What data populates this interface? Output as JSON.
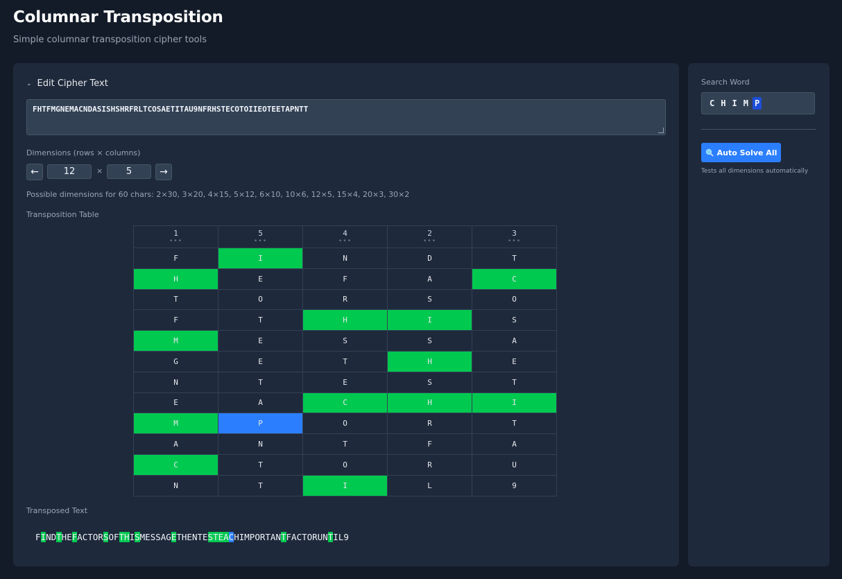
{
  "header": {
    "title": "Columnar Transposition",
    "subtitle": "Simple columnar transposition cipher tools"
  },
  "editor": {
    "toggle_label": "Edit Cipher Text",
    "cipher_text": "FHTFMGNEMACNDASISHSHRFRLTCOSAETITAU9NFRHSTECOTOIIEOTEETAPNTT"
  },
  "dimensions": {
    "label": "Dimensions (rows × columns)",
    "prev_label": "←",
    "next_label": "→",
    "rows": "12",
    "times": "×",
    "cols": "5",
    "possible_text": "Possible dimensions for 60 chars: 2×30, 3×20, 4×15, 5×12, 6×10, 10×6, 12×5, 15×4, 20×3, 30×2"
  },
  "table": {
    "label": "Transposition Table",
    "headers": [
      "1",
      "5",
      "4",
      "2",
      "3"
    ],
    "rows": [
      [
        "F",
        "I",
        "N",
        "D",
        "T"
      ],
      [
        "H",
        "E",
        "F",
        "A",
        "C"
      ],
      [
        "T",
        "O",
        "R",
        "S",
        "O"
      ],
      [
        "F",
        "T",
        "H",
        "I",
        "S"
      ],
      [
        "M",
        "E",
        "S",
        "S",
        "A"
      ],
      [
        "G",
        "E",
        "T",
        "H",
        "E"
      ],
      [
        "N",
        "T",
        "E",
        "S",
        "T"
      ],
      [
        "E",
        "A",
        "C",
        "H",
        "I"
      ],
      [
        "M",
        "P",
        "O",
        "R",
        "T"
      ],
      [
        "A",
        "N",
        "T",
        "F",
        "A"
      ],
      [
        "C",
        "T",
        "O",
        "R",
        "U"
      ],
      [
        "N",
        "T",
        "I",
        "L",
        "9"
      ]
    ],
    "highlights": [
      [
        "",
        "g",
        "",
        "",
        ""
      ],
      [
        "g",
        "",
        "",
        "",
        "g"
      ],
      [
        "",
        "",
        "",
        "",
        ""
      ],
      [
        "",
        "",
        "g",
        "g",
        ""
      ],
      [
        "g",
        "",
        "",
        "",
        ""
      ],
      [
        "",
        "",
        "",
        "g",
        ""
      ],
      [
        "",
        "",
        "",
        "",
        ""
      ],
      [
        "",
        "",
        "g",
        "g",
        "g"
      ],
      [
        "g",
        "b",
        "",
        "",
        ""
      ],
      [
        "",
        "",
        "",
        "",
        ""
      ],
      [
        "g",
        "",
        "",
        "",
        ""
      ],
      [
        "",
        "",
        "g",
        "",
        ""
      ]
    ]
  },
  "transposed": {
    "label": "Transposed Text",
    "text": "FINDTHEFACTORSOFTHISMESSAGETHENTESTEACHIMPORTANTFACTORUNTIL9",
    "highlights": "_g__g__g_____g__gg_g______g______ggggb_________g________g___"
  },
  "sidebar": {
    "search_label": "Search Word",
    "search_chars": [
      "C",
      "H",
      "I",
      "M",
      "P"
    ],
    "selected_index": 4,
    "solve_icon": "search-icon",
    "solve_label": "Auto Solve All",
    "solve_hint": "Tests all dimensions automatically"
  },
  "colors": {
    "background": "#131b28",
    "panel": "#1e293b",
    "match_green": "#00c950",
    "active_blue": "#2b7fff"
  }
}
